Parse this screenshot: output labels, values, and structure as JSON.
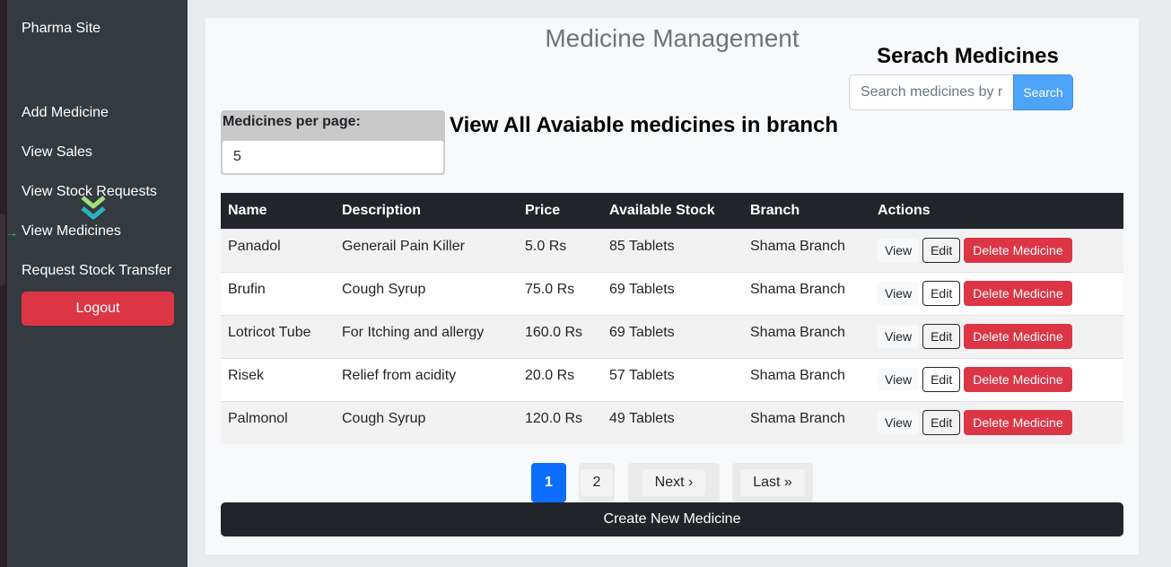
{
  "sidebar": {
    "brand": "Pharma Site",
    "items": [
      {
        "label": "Add Medicine"
      },
      {
        "label": "View Sales"
      },
      {
        "label": "View Stock Requests"
      },
      {
        "label": "View Medicines"
      },
      {
        "label": "Request Stock Transfer"
      }
    ],
    "logout_label": "Logout"
  },
  "header": {
    "title": "Medicine Management",
    "search_heading": "Serach Medicines",
    "search_placeholder": "Search medicines by name",
    "search_button": "Search"
  },
  "controls": {
    "per_page_label": "Medicines per page:",
    "per_page_value": "5",
    "view_heading": "View All Avaiable medicines in branch"
  },
  "table": {
    "columns": [
      "Name",
      "Description",
      "Price",
      "Available Stock",
      "Branch",
      "Actions"
    ],
    "rows": [
      [
        "Panadol",
        "Generail Pain Killer",
        "5.0 Rs",
        "85 Tablets",
        "Shama Branch"
      ],
      [
        "Brufin",
        "Cough Syrup",
        "75.0 Rs",
        "69 Tablets",
        "Shama Branch"
      ],
      [
        "Lotricot Tube",
        "For Itching and allergy",
        "160.0 Rs",
        "69 Tablets",
        "Shama Branch"
      ],
      [
        "Risek",
        "Relief from acidity",
        "20.0 Rs",
        "57 Tablets",
        "Shama Branch"
      ],
      [
        "Palmonol",
        "Cough Syrup",
        "120.0 Rs",
        "49 Tablets",
        "Shama Branch"
      ]
    ],
    "action_labels": {
      "view": "View",
      "edit": "Edit",
      "delete": "Delete Medicine"
    }
  },
  "pagination": {
    "page1": "1",
    "page2": "2",
    "next": "Next ›",
    "last": "Last »"
  },
  "create_button": "Create New Medicine",
  "colors": {
    "sidebar_bg": "#343a40",
    "danger": "#dc3545",
    "primary": "#0d6efd",
    "search_btn": "#4da3f7",
    "dark": "#212529"
  }
}
